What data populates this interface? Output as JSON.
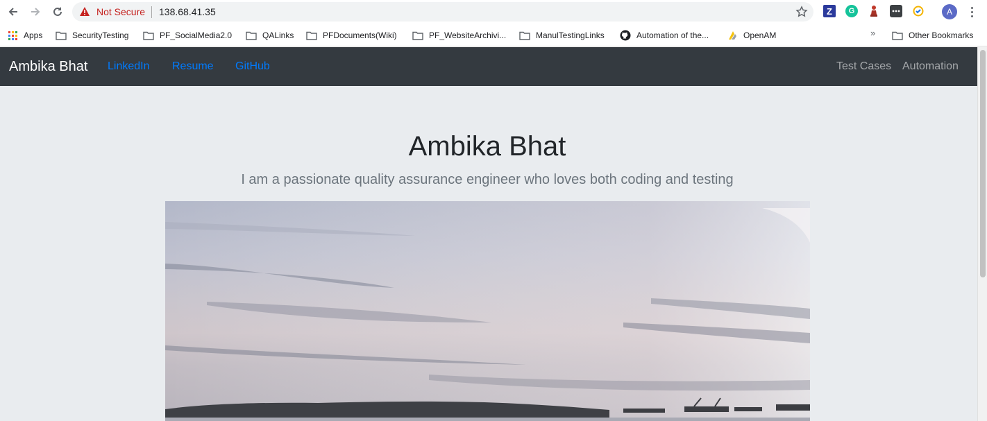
{
  "browser": {
    "security_label": "Not Secure",
    "url": "138.68.41.35",
    "extensions": {
      "z_label": "Z",
      "grammarly_label": "G",
      "profile_initial": "A"
    },
    "bookmarks": [
      {
        "label": "Apps",
        "icon": "apps-grid-icon"
      },
      {
        "label": "SecurityTesting",
        "icon": "folder-icon"
      },
      {
        "label": "PF_SocialMedia2.0",
        "icon": "folder-icon"
      },
      {
        "label": "QALinks",
        "icon": "folder-icon"
      },
      {
        "label": "PFDocuments(Wiki)",
        "icon": "folder-icon"
      },
      {
        "label": "PF_WebsiteArchivi...",
        "icon": "folder-icon"
      },
      {
        "label": "ManulTestingLinks",
        "icon": "folder-icon"
      },
      {
        "label": "Automation of the...",
        "icon": "github-icon"
      },
      {
        "label": "OpenAM",
        "icon": "openam-icon"
      }
    ],
    "overflow_label": "»",
    "other_bookmarks": "Other Bookmarks"
  },
  "navbar": {
    "brand": "Ambika Bhat",
    "links": [
      "LinkedIn",
      "Resume",
      "GitHub"
    ],
    "right_links": [
      "Test Cases",
      "Automation"
    ]
  },
  "hero": {
    "title": "Ambika Bhat",
    "lead": "I am a passionate quality assurance engineer who loves both coding and testing"
  },
  "colors": {
    "navbar_bg": "#343a40",
    "link_blue": "#007bff",
    "page_bg": "#e9ecef",
    "not_secure_red": "#c5221f"
  }
}
